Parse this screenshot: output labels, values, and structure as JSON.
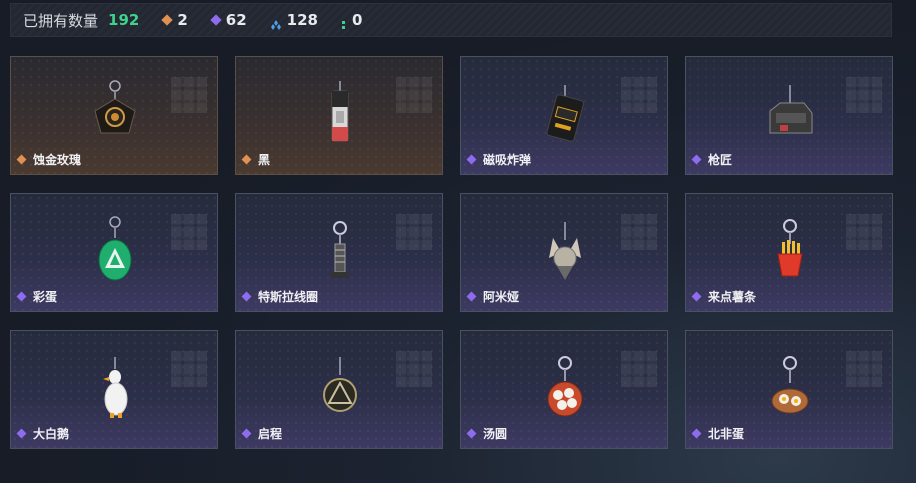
{
  "header": {
    "label": "已拥有数量",
    "total": "192",
    "stats": [
      {
        "icon": "orange-diamond-icon",
        "color": "#e09050",
        "value": "2"
      },
      {
        "icon": "purple-diamond-icon",
        "color": "#8e6cf0",
        "value": "62"
      },
      {
        "icon": "blue-diamond-icon",
        "color": "#4fa0e8",
        "value": "128"
      },
      {
        "icon": "green-dots-icon",
        "color": "#40d090",
        "value": "0"
      }
    ]
  },
  "items": [
    {
      "name": "蚀金玫瑰",
      "rarity": "orange",
      "icon": "gold-rose-keychain-icon"
    },
    {
      "name": "黑",
      "rarity": "orange",
      "icon": "black-tag-keychain-icon"
    },
    {
      "name": "磁吸炸弹",
      "rarity": "purple",
      "icon": "magnetic-bomb-keychain-icon"
    },
    {
      "name": "枪匠",
      "rarity": "purple",
      "icon": "gunsmith-keychain-icon"
    },
    {
      "name": "彩蛋",
      "rarity": "purple",
      "icon": "easter-egg-keychain-icon"
    },
    {
      "name": "特斯拉线圈",
      "rarity": "purple",
      "icon": "tesla-coil-keychain-icon"
    },
    {
      "name": "阿米娅",
      "rarity": "purple",
      "icon": "amiya-keychain-icon"
    },
    {
      "name": "来点薯条",
      "rarity": "purple",
      "icon": "fries-keychain-icon"
    },
    {
      "name": "大白鹅",
      "rarity": "purple",
      "icon": "white-goose-keychain-icon"
    },
    {
      "name": "启程",
      "rarity": "purple",
      "icon": "departure-keychain-icon"
    },
    {
      "name": "汤圆",
      "rarity": "purple",
      "icon": "tangyuan-keychain-icon"
    },
    {
      "name": "北非蛋",
      "rarity": "purple",
      "icon": "shakshuka-keychain-icon"
    }
  ]
}
